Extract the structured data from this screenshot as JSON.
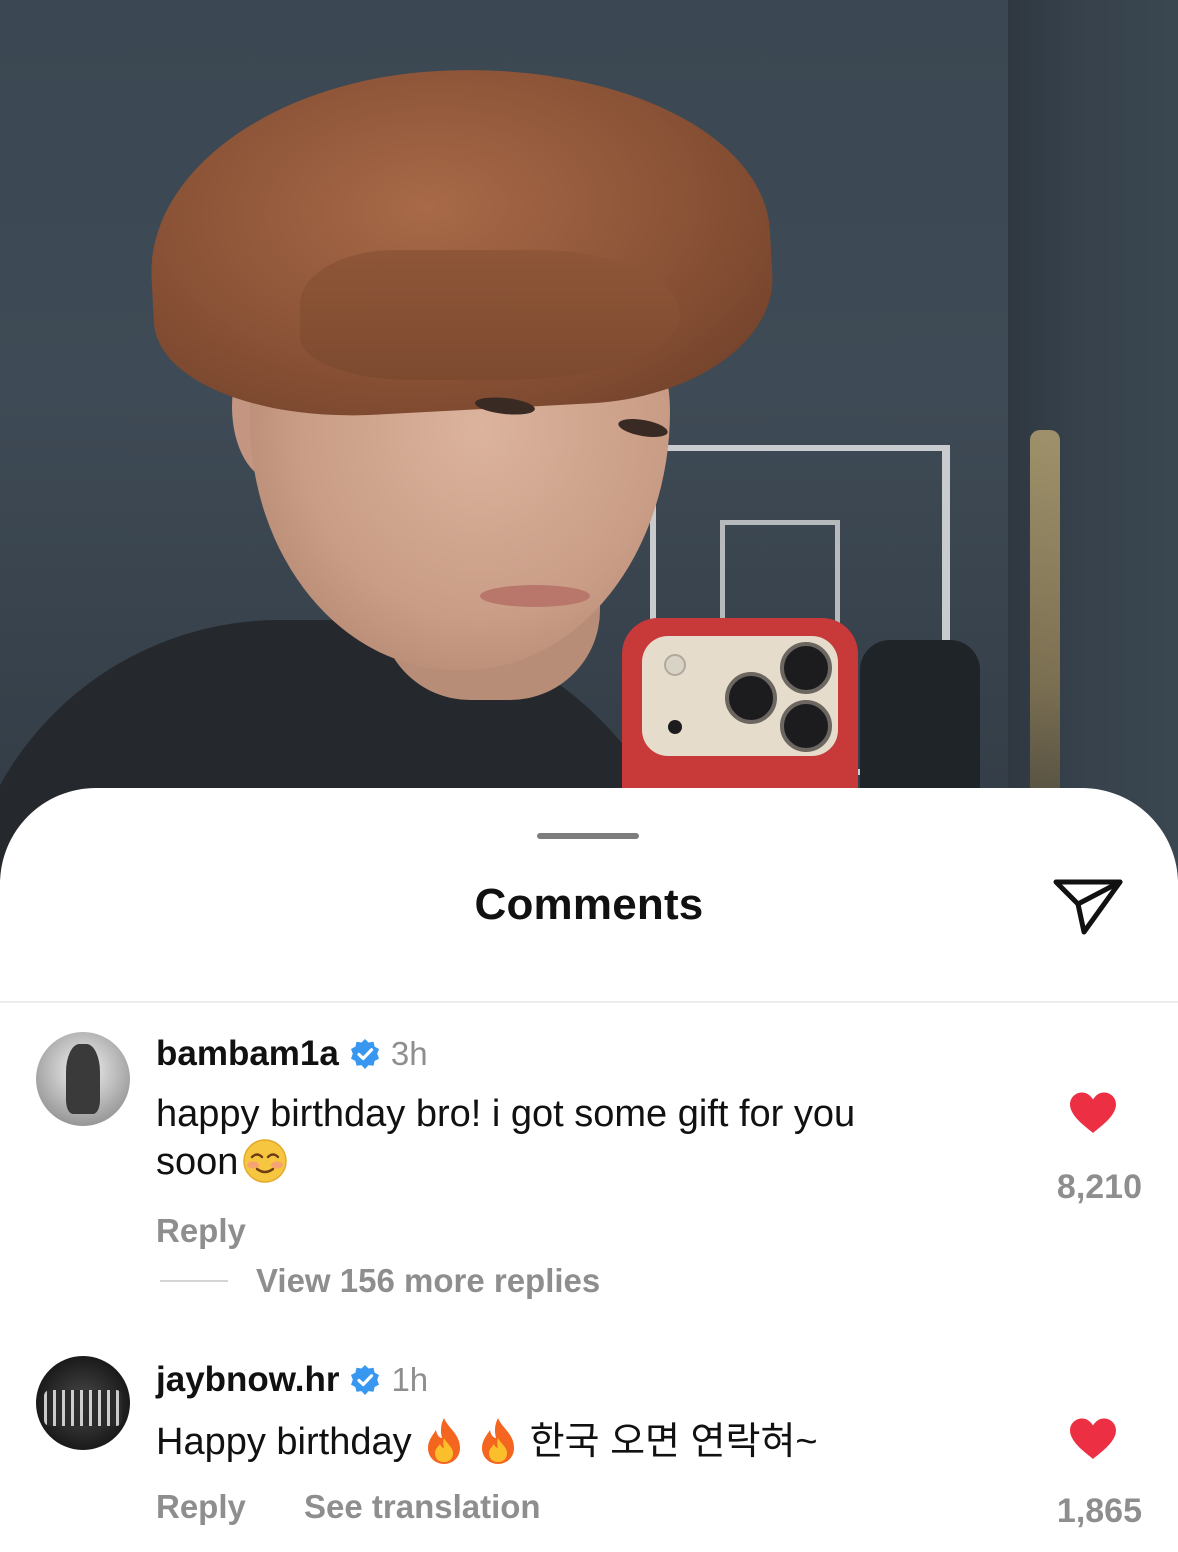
{
  "sheet": {
    "title": "Comments",
    "share_icon": "send-icon"
  },
  "comments": [
    {
      "username": "bambam1a",
      "verified": true,
      "time": "3h",
      "text_line1": "happy birthday bro! i got some gift for you",
      "text_line2": "soon",
      "emoji": "smiling-blush-emoji",
      "reply_label": "Reply",
      "view_replies_label": "View 156 more replies",
      "like_count": "8,210",
      "liked": true
    },
    {
      "username": "jaybnow.hr",
      "verified": true,
      "time": "1h",
      "text_part1": "Happy birthday",
      "text_part2": "한국 오면 연락혀~",
      "emoji": "fire-emoji",
      "reply_label": "Reply",
      "translation_label": "See translation",
      "like_count": "1,865",
      "liked": true
    }
  ],
  "colors": {
    "heart": "#ed2f44",
    "verified": "#3897f0",
    "muted_text": "#8e8e8e",
    "primary_text": "#111111"
  }
}
